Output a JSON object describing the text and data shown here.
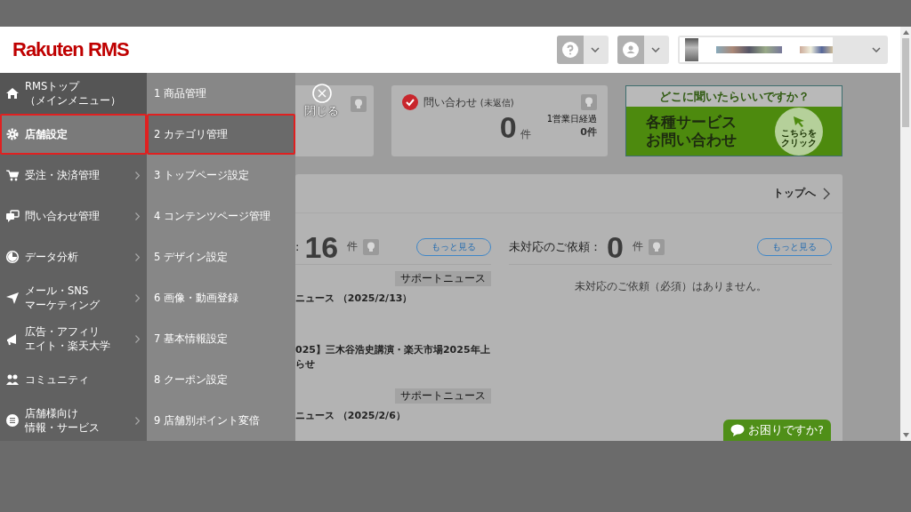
{
  "header": {
    "logo": "Rakuten RMS"
  },
  "main_menu": [
    {
      "lines": [
        "RMSトップ",
        "（メインメニュー）"
      ],
      "selected": false,
      "has_submenu": false,
      "highlighted": false
    },
    {
      "lines": [
        "店舗設定"
      ],
      "selected": true,
      "has_submenu": false,
      "highlighted": true
    },
    {
      "lines": [
        "受注・決済管理"
      ],
      "selected": false,
      "has_submenu": true,
      "highlighted": false
    },
    {
      "lines": [
        "問い合わせ管理"
      ],
      "selected": false,
      "has_submenu": true,
      "highlighted": false
    },
    {
      "lines": [
        "データ分析"
      ],
      "selected": false,
      "has_submenu": true,
      "highlighted": false
    },
    {
      "lines": [
        "メール・SNS",
        "マーケティング"
      ],
      "selected": false,
      "has_submenu": true,
      "highlighted": false
    },
    {
      "lines": [
        "広告・アフィリ",
        "エイト・楽天大学"
      ],
      "selected": false,
      "has_submenu": true,
      "highlighted": false
    },
    {
      "lines": [
        "コミュニティ"
      ],
      "selected": false,
      "has_submenu": false,
      "highlighted": false
    },
    {
      "lines": [
        "店舗様向け",
        "情報・サービス"
      ],
      "selected": false,
      "has_submenu": true,
      "highlighted": false
    }
  ],
  "sub_menu": [
    {
      "label": "1 商品管理",
      "selected": false,
      "highlighted": false
    },
    {
      "label": "2 カテゴリ管理",
      "selected": true,
      "highlighted": true
    },
    {
      "label": "3 トップページ設定",
      "selected": false,
      "highlighted": false
    },
    {
      "label": "4 コンテンツページ管理",
      "selected": false,
      "highlighted": false
    },
    {
      "label": "5 デザイン設定",
      "selected": false,
      "highlighted": false
    },
    {
      "label": "6 画像・動画登録",
      "selected": false,
      "highlighted": false
    },
    {
      "label": "7 基本情報設定",
      "selected": false,
      "highlighted": false
    },
    {
      "label": "8 クーポン設定",
      "selected": false,
      "highlighted": false
    },
    {
      "label": "9 店舗別ポイント変倍",
      "selected": false,
      "highlighted": false
    }
  ],
  "close_button": {
    "label": "閉じる"
  },
  "inquiry_card": {
    "title": "問い合わせ",
    "note": "(未返信)",
    "count": "0",
    "unit": "件",
    "sub_label": "1営業日経過",
    "sub_count": "0件"
  },
  "banner": {
    "question": "どこに聞いたらいいですか？",
    "lines": [
      "各種サービス",
      "お問い合わせ"
    ],
    "click_lines": [
      "こちらを",
      "クリック"
    ]
  },
  "panel": {
    "top_link": "トップへ",
    "left": {
      "prefix": ":",
      "count": "16",
      "unit": "件",
      "more": "もっと見る",
      "news": [
        {
          "tag": "サポートニュース",
          "lines": [
            "ニュース （2025/2/13）"
          ]
        },
        {
          "lines": [
            "025】三木谷浩史講演・楽天市場2025年上",
            "らせ"
          ]
        },
        {
          "tag": "サポートニュース",
          "lines": [
            "ニュース （2025/2/6）"
          ]
        }
      ]
    },
    "right": {
      "label": "未対応のご依頼：",
      "count": "0",
      "unit": "件",
      "more": "もっと見る",
      "empty": "未対応のご依頼（必須）はありません。"
    }
  },
  "chat_button": {
    "label": "お困りですか?"
  }
}
